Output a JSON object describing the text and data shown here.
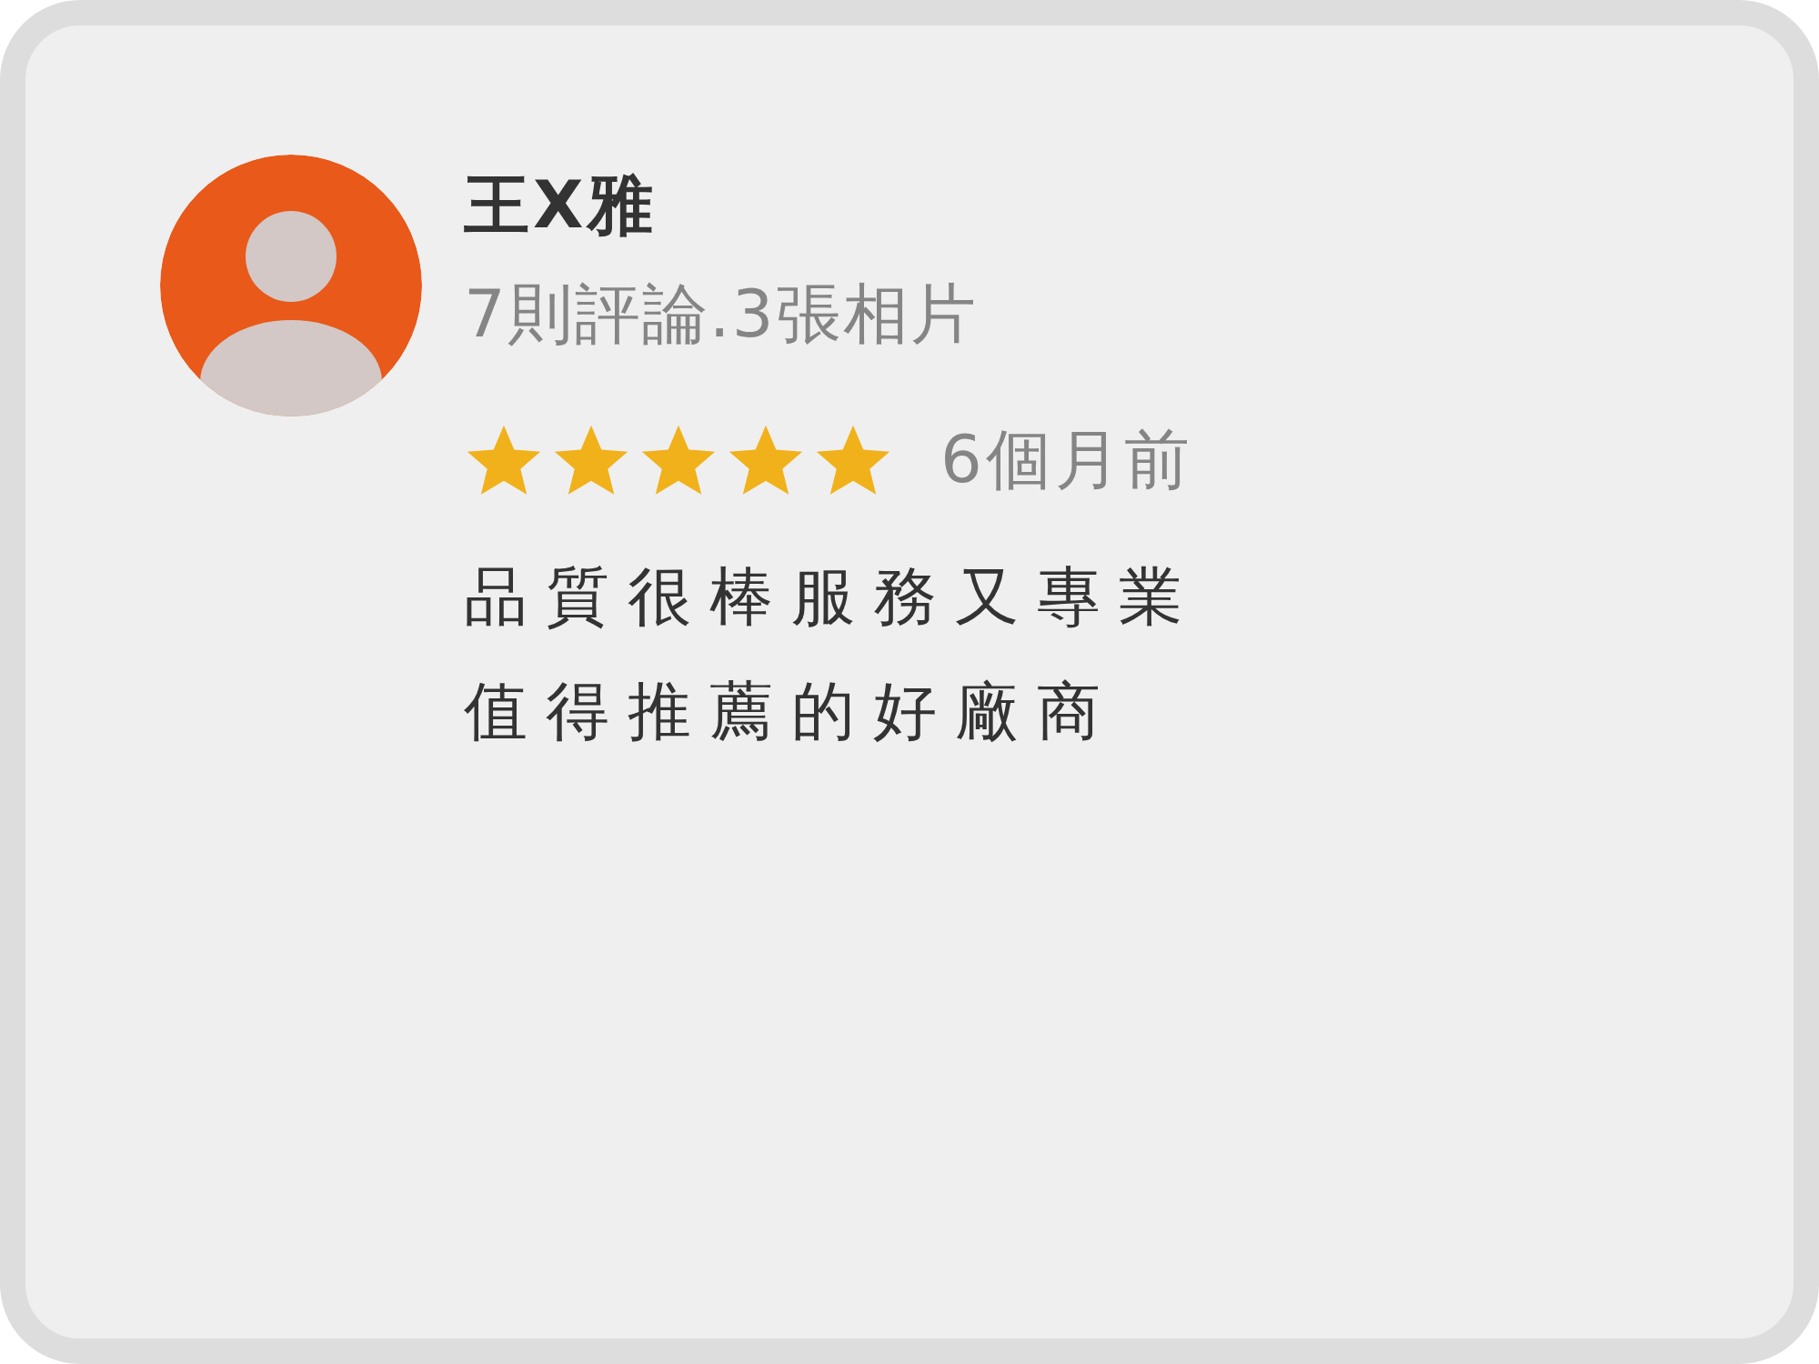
{
  "review": {
    "author": "王X雅",
    "meta": "7則評論.3張相片",
    "stars": 5,
    "time": "6個月前",
    "text_lines": [
      "品質很棒服務又專業",
      "值得推薦的好廠商"
    ]
  }
}
